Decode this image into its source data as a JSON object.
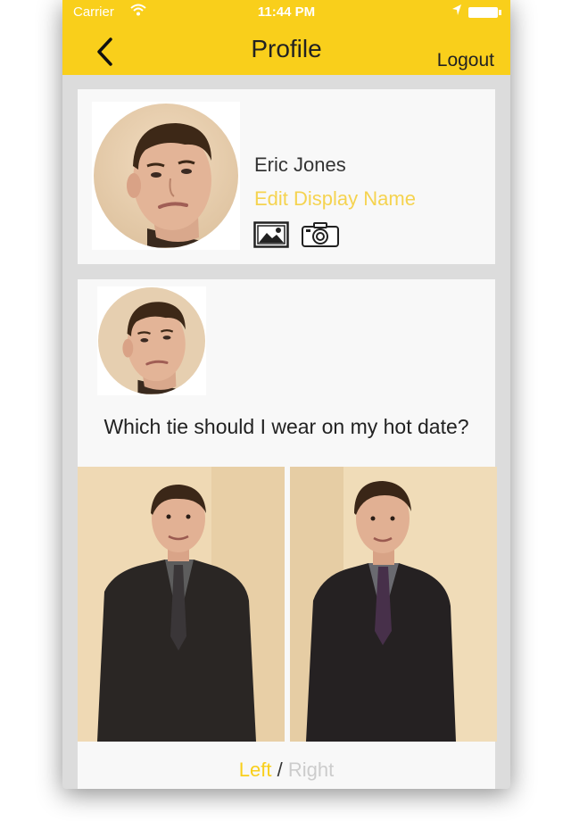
{
  "status_bar": {
    "carrier": "Carrier",
    "time": "11:44 PM"
  },
  "nav": {
    "title": "Profile",
    "logout_label": "Logout"
  },
  "profile": {
    "display_name": "Eric Jones",
    "edit_display_name_label": "Edit Display Name"
  },
  "post": {
    "question": "Which tie should I wear on my hot date?",
    "left_label": "Left",
    "separator": "/",
    "right_label": "Right"
  },
  "colors": {
    "accent": "#f9cf1b",
    "edit_link": "#f5d34f",
    "inactive_option": "#cccccc",
    "card_background": "#f8f8f8",
    "page_background": "#dcdcdc"
  },
  "icons": [
    "back-chevron-icon",
    "wifi-icon",
    "location-arrow-icon",
    "battery-icon",
    "photo-gallery-icon",
    "camera-icon"
  ]
}
